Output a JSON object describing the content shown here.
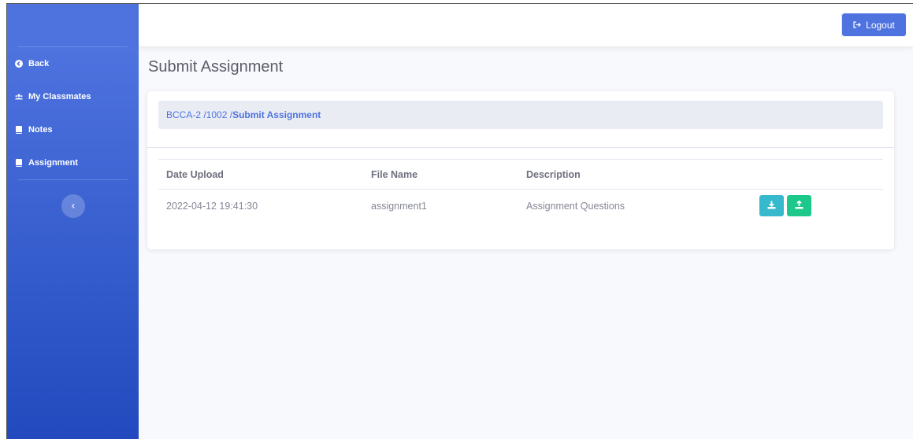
{
  "colors": {
    "sidebar_top": "#4e73df",
    "sidebar_bottom": "#224abe",
    "primary": "#4e73df",
    "info": "#36b9cc",
    "success": "#1cc88a"
  },
  "sidebar": {
    "items": [
      {
        "label": "Back",
        "icon": "arrow-circle-left-icon"
      },
      {
        "label": "My Classmates",
        "icon": "users-icon"
      },
      {
        "label": "Notes",
        "icon": "book-icon"
      },
      {
        "label": "Assignment",
        "icon": "book-icon"
      }
    ],
    "toggle_icon": "chevron-left-icon"
  },
  "topbar": {
    "logout_label": "Logout",
    "logout_icon": "sign-out-icon"
  },
  "page": {
    "title": "Submit Assignment"
  },
  "breadcrumb": {
    "part1": "BCCA-2 /",
    "part2": "1002 /",
    "active": "Submit Assignment"
  },
  "table": {
    "headers": [
      "Date Upload",
      "File Name",
      "Description",
      ""
    ],
    "rows": [
      {
        "date": "2022-04-12 19:41:30",
        "file": "assignment1",
        "description": "Assignment Questions",
        "actions": [
          "download-icon",
          "upload-icon"
        ]
      }
    ]
  }
}
